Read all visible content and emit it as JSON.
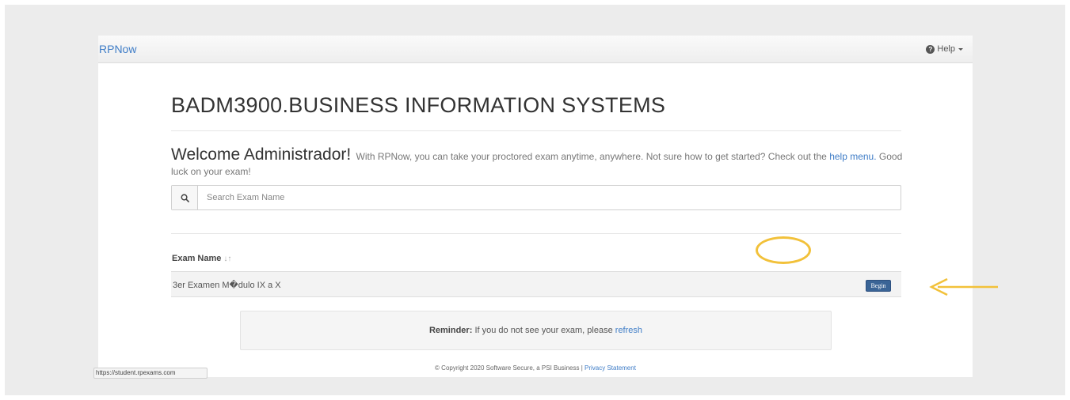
{
  "navbar": {
    "brand": "RPNow",
    "help_label": "Help"
  },
  "page": {
    "title": "BADM3900.BUSINESS INFORMATION SYSTEMS",
    "welcome_heading": "Welcome Administrador!",
    "welcome_text": "With RPNow, you can take your proctored exam anytime, anywhere. Not sure how to get started? Check out the",
    "help_link": "help menu.",
    "good_luck": "Good luck on your exam!"
  },
  "search": {
    "placeholder": "Search Exam Name",
    "icon": "search-icon"
  },
  "table": {
    "column_header": "Exam Name",
    "sort_glyph": "↓↑",
    "rows": [
      {
        "name": "3er Examen M�dulo IX a X",
        "action": "Begin"
      }
    ]
  },
  "reminder": {
    "label": "Reminder:",
    "text": "If you do not see your exam, please",
    "link": "refresh"
  },
  "footer": {
    "copyright": "© Copyright 2020 Software Secure, a PSI Business |",
    "privacy_link": "Privacy Statement"
  },
  "status_bar": {
    "url": "https://student.rpexams.com"
  },
  "colors": {
    "brand_link": "#3f7dc7",
    "begin_button": "#3a6496",
    "annotation": "#f2c13a"
  }
}
